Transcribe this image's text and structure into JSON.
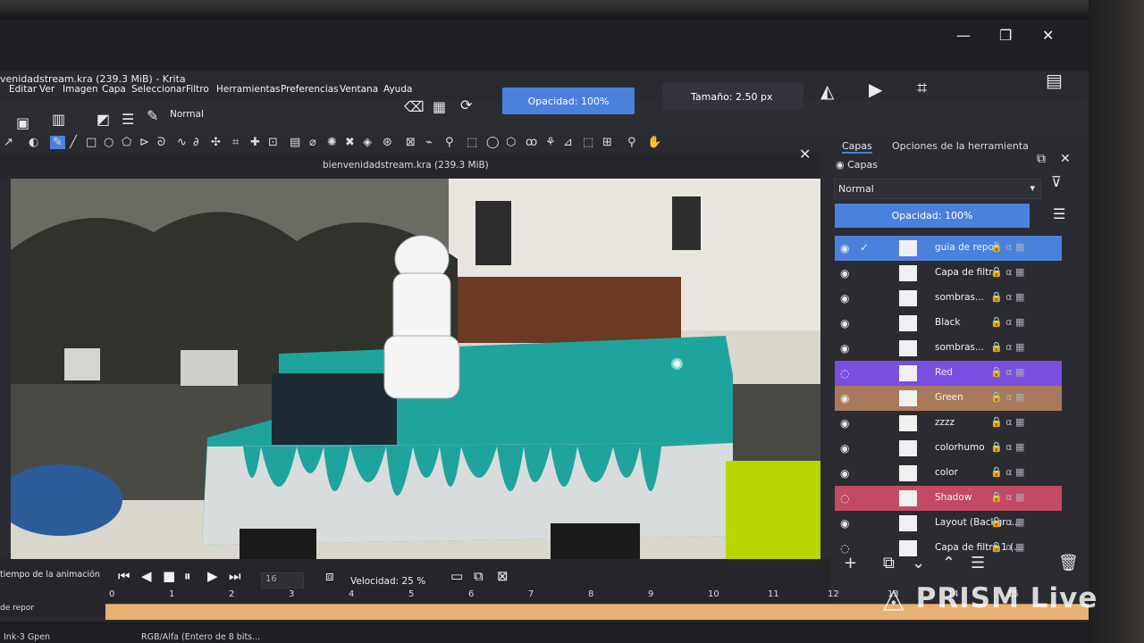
{
  "window": {
    "title": "venidadstream.kra (239.3 MiB) - Krita",
    "minimize": "—",
    "maximize": "❐",
    "close": "✕"
  },
  "menu": [
    "Editar",
    "Ver",
    "Imagen",
    "Capa",
    "Seleccionar",
    "Filtro",
    "Herramientas",
    "Preferencias",
    "Ventana",
    "Ayuda"
  ],
  "toolbar": {
    "blend_mode": "Normal",
    "opacity": "Opacidad: 100%",
    "size": "Tamaño: 2.50 px"
  },
  "canvas": {
    "title": "bienvenidadstream.kra (239.3 MiB)"
  },
  "docker": {
    "tabs": [
      "Capas",
      "Opciones de la herramienta"
    ],
    "header": "Capas",
    "blend_mode": "Normal",
    "opacity": "Opacidad:  100%",
    "layers": [
      {
        "name": "guia de repor",
        "visible": true,
        "selected": true,
        "color": "#4b80dd"
      },
      {
        "name": "Capa de filtr...",
        "visible": true,
        "selected": false,
        "color": ""
      },
      {
        "name": "sombras...",
        "visible": true,
        "selected": false,
        "color": ""
      },
      {
        "name": "Black",
        "visible": true,
        "selected": false,
        "color": ""
      },
      {
        "name": "sombras...",
        "visible": true,
        "selected": false,
        "color": ""
      },
      {
        "name": "Red",
        "visible": false,
        "selected": false,
        "color": "#7a4fe0"
      },
      {
        "name": "Green",
        "visible": true,
        "selected": false,
        "color": "#a8795a"
      },
      {
        "name": "zzzz",
        "visible": true,
        "selected": false,
        "color": ""
      },
      {
        "name": "colorhumo",
        "visible": true,
        "selected": false,
        "color": ""
      },
      {
        "name": "color",
        "visible": true,
        "selected": false,
        "color": ""
      },
      {
        "name": "Shadow",
        "visible": false,
        "selected": false,
        "color": "#c24a66"
      },
      {
        "name": "Layout (Backgro...",
        "visible": true,
        "selected": false,
        "color": ""
      },
      {
        "name": "Capa de filtro 1 (...",
        "visible": false,
        "selected": false,
        "color": ""
      }
    ]
  },
  "animation": {
    "label": "tiempo de la animación",
    "frame": "16",
    "speed": "Velocidad: 25 %",
    "layer_name": "de repor",
    "ruler": [
      "0",
      "1",
      "2",
      "3",
      "4",
      "5",
      "6",
      "7",
      "8",
      "9",
      "10",
      "11",
      "12",
      "13",
      "14",
      "15"
    ]
  },
  "status": {
    "left": "Ink-3 Gpen",
    "mid": "RGB/Alfa (Entero de 8 bits..."
  },
  "watermark": "PRISM Live"
}
